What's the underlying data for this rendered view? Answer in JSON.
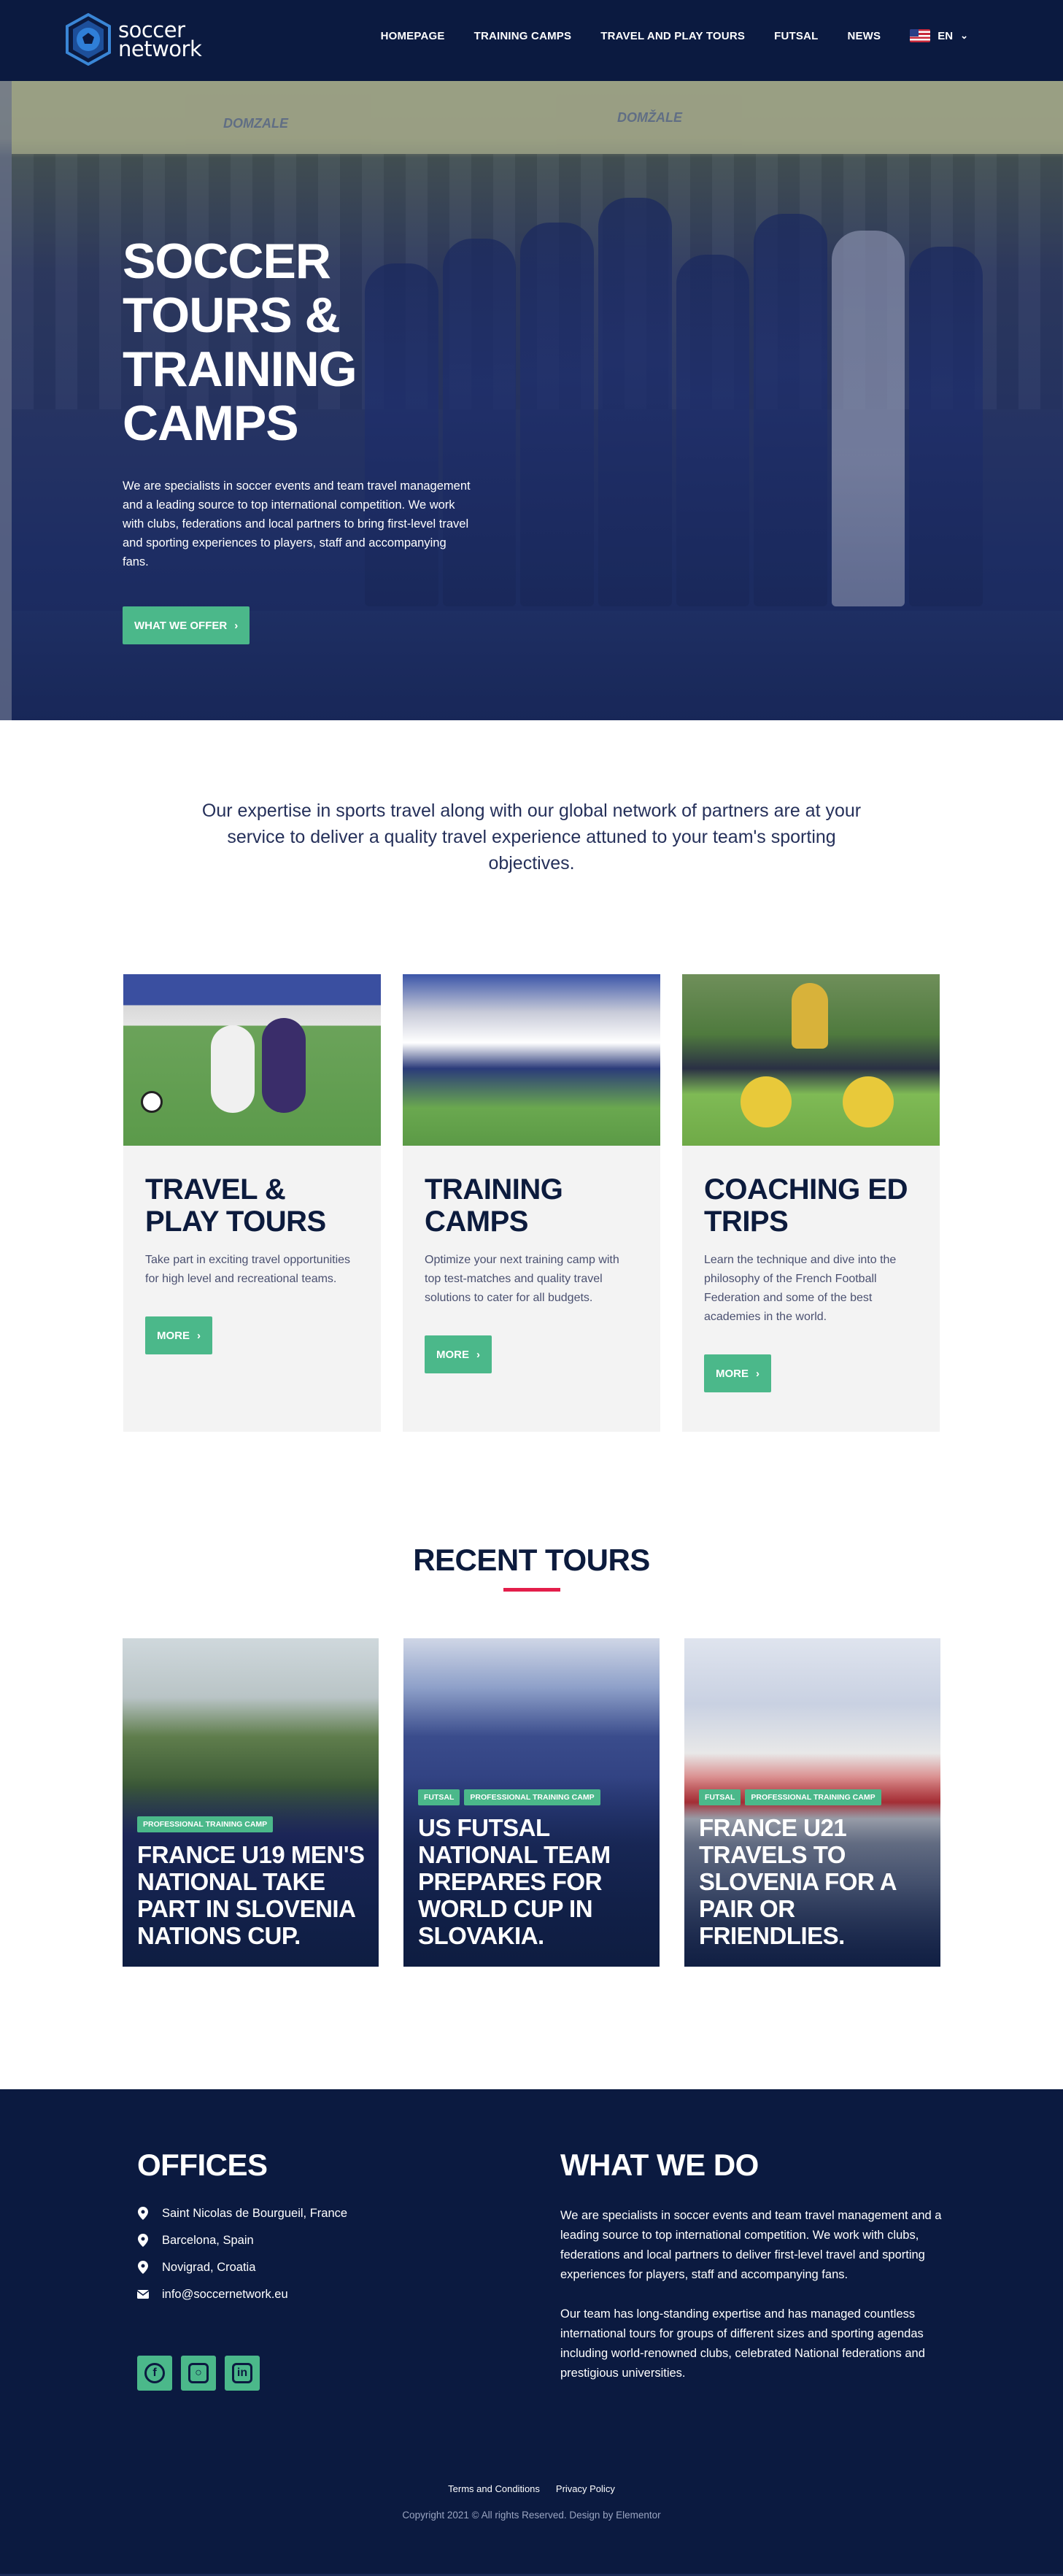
{
  "header": {
    "logo_top": "soccer",
    "logo_bottom": "network",
    "nav": [
      "HOMEPAGE",
      "TRAINING CAMPS",
      "TRAVEL AND PLAY TOURS",
      "FUTSAL",
      "NEWS"
    ],
    "language": "EN"
  },
  "hero": {
    "sponsors": [
      "DOMZALE",
      "DOMŽALE"
    ],
    "title_line1": "SOCCER TOURS &",
    "title_line2": "TRAINING CAMPS",
    "text": "We are specialists in soccer events and team travel management and a leading source to top international competition. We work with clubs, federations and local partners to bring first-level travel and sporting experiences to players, staff and accompanying fans.",
    "button": "WHAT WE OFFER"
  },
  "intro": {
    "text": "Our expertise in sports travel along with our global network of partners are at your service to deliver a quality travel experience attuned to your team's sporting objectives."
  },
  "services": [
    {
      "title": "TRAVEL & PLAY TOURS",
      "text": "Take part in exciting travel opportunities for high level and recreational teams.",
      "button": "MORE"
    },
    {
      "title": "TRAINING CAMPS",
      "text": "Optimize your next training camp with top test-matches and quality travel solutions to cater for all budgets.",
      "button": "MORE"
    },
    {
      "title": "COACHING ED TRIPS",
      "text": "Learn the technique and dive into the philosophy of the French Football Federation and some of the best academies in the world.",
      "button": "MORE"
    }
  ],
  "recent": {
    "title": "RECENT TOURS",
    "tours": [
      {
        "tags": [
          "PROFESSIONAL TRAINING CAMP"
        ],
        "title": "FRANCE U19 MEN'S NATIONAL TAKE PART IN SLOVENIA NATIONS CUP."
      },
      {
        "tags": [
          "FUTSAL",
          "PROFESSIONAL TRAINING CAMP"
        ],
        "title": "US FUTSAL NATIONAL TEAM PREPARES FOR WORLD CUP IN SLOVAKIA."
      },
      {
        "tags": [
          "FUTSAL",
          "PROFESSIONAL TRAINING CAMP"
        ],
        "title": "FRANCE U21 TRAVELS TO SLOVENIA FOR A PAIR OR FRIENDLIES."
      }
    ]
  },
  "footer": {
    "offices_title": "OFFICES",
    "offices": [
      {
        "icon": "map-pin-icon",
        "text": "Saint Nicolas de Bourgueil, France"
      },
      {
        "icon": "map-pin-icon",
        "text": "Barcelona, Spain"
      },
      {
        "icon": "map-pin-icon",
        "text": "Novigrad, Croatia"
      },
      {
        "icon": "envelope-icon",
        "text": "info@soccernetwork.eu"
      }
    ],
    "socials": [
      "facebook-icon",
      "instagram-icon",
      "linkedin-icon"
    ],
    "offer_title": "WHAT WE DO",
    "offer_p1": "We are specialists in soccer events and team travel management and a leading source to top international competition. We work with clubs, federations and local partners to deliver first-level travel and sporting experiences for players, staff and accompanying fans.",
    "offer_p2": "Our team has long-standing expertise and has managed countless international tours for groups of different sizes and sporting agendas including world-renowned clubs, celebrated National federations and prestigious universities.",
    "links": [
      "Terms and Conditions",
      "Privacy Policy"
    ],
    "copyright": "Copyright 2021 © All rights Reserved. Design by Elementor"
  },
  "colors": {
    "navy": "#0b1a40",
    "green": "#4bb88a",
    "red": "#e31e4a"
  }
}
